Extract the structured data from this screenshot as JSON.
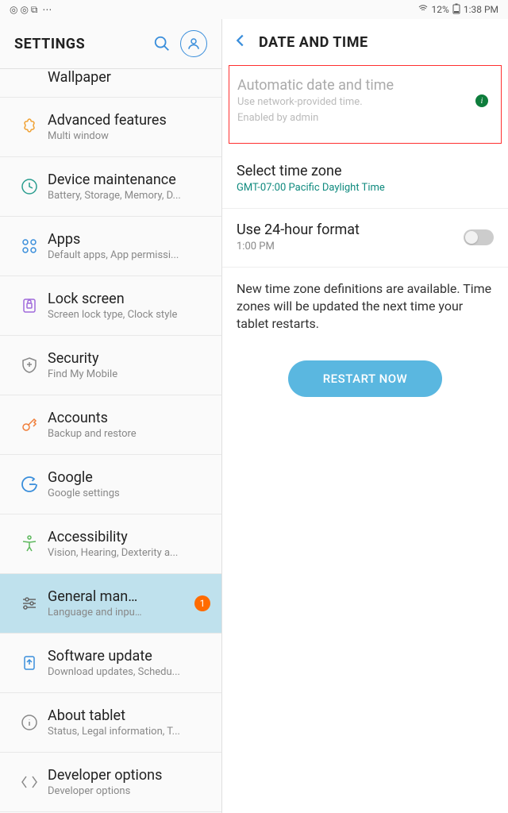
{
  "status": {
    "battery_pct": "12%",
    "time": "1:38 PM"
  },
  "sidebar": {
    "title": "SETTINGS",
    "items": [
      {
        "title": "Wallpaper",
        "sub": ""
      },
      {
        "title": "Advanced features",
        "sub": "Multi window"
      },
      {
        "title": "Device maintenance",
        "sub": "Battery, Storage, Memory, D..."
      },
      {
        "title": "Apps",
        "sub": "Default apps, App permissi..."
      },
      {
        "title": "Lock screen",
        "sub": "Screen lock type, Clock style"
      },
      {
        "title": "Security",
        "sub": "Find My Mobile"
      },
      {
        "title": "Accounts",
        "sub": "Backup and restore"
      },
      {
        "title": "Google",
        "sub": "Google settings"
      },
      {
        "title": "Accessibility",
        "sub": "Vision, Hearing, Dexterity a..."
      },
      {
        "title": "General man…",
        "sub": "Language and inpu…",
        "badge": "1"
      },
      {
        "title": "Software update",
        "sub": "Download updates, Schedu..."
      },
      {
        "title": "About tablet",
        "sub": "Status, Legal information, T..."
      },
      {
        "title": "Developer options",
        "sub": "Developer options"
      }
    ]
  },
  "detail": {
    "title": "DATE AND TIME",
    "auto": {
      "title": "Automatic date and time",
      "sub1": "Use network-provided time.",
      "sub2": "Enabled by admin"
    },
    "tz": {
      "title": "Select time zone",
      "value": "GMT-07:00 Pacific Daylight Time"
    },
    "fmt": {
      "title": "Use 24-hour format",
      "example": "1:00 PM"
    },
    "info_text": "New time zone definitions are available. Time zones will be updated the next time your tablet restarts.",
    "restart_label": "RESTART NOW"
  }
}
